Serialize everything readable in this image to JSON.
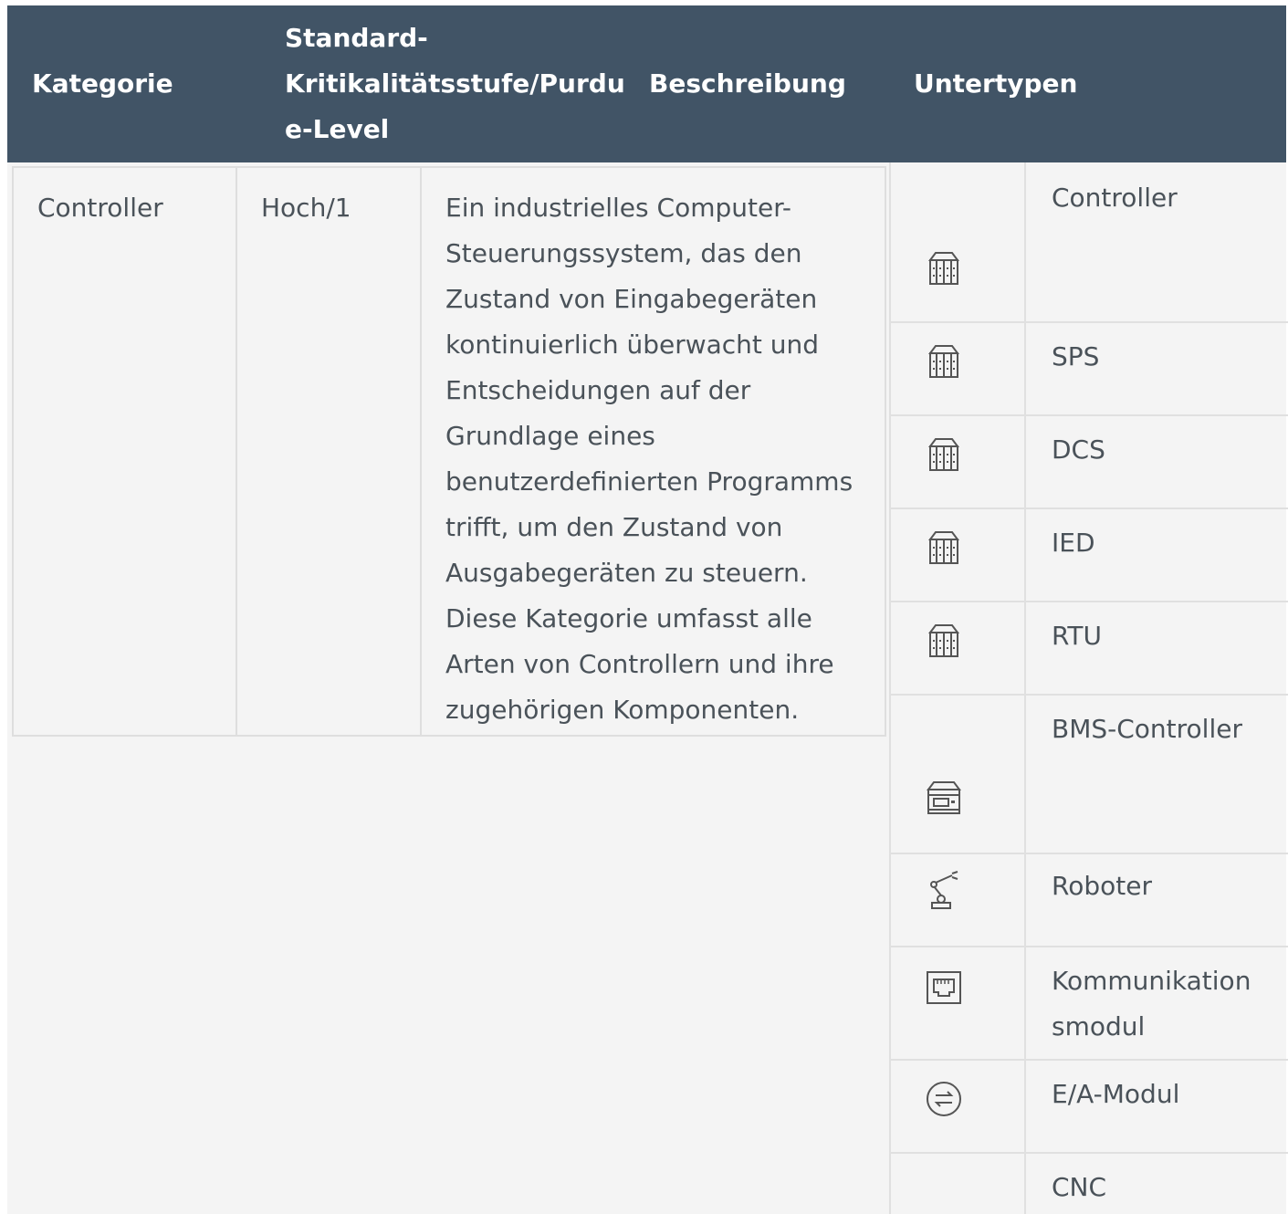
{
  "header": {
    "kategorie": "Kategorie",
    "standard_line1": "Standard-",
    "standard_line2": "Kritikalitätsstufe/Purdu",
    "standard_line3": "e-Level",
    "beschreibung": "Beschreibung",
    "untertypen": "Untertypen"
  },
  "row": {
    "kategorie": "Controller",
    "level": "Hoch/1",
    "beschreibung_lines": [
      "Ein industrielles Computer-",
      "Steuerungssystem, das den",
      "Zustand von Eingabegeräten",
      "kontinuierlich überwacht und",
      "Entscheidungen auf der",
      "Grundlage eines",
      "benutzerdefinierten Programms",
      "trifft, um den Zustand von",
      "Ausgabegeräten zu steuern.",
      "Diese Kategorie umfasst alle",
      "Arten von Controllern und ihre",
      "zugehörigen Komponenten."
    ]
  },
  "subtypes": [
    {
      "label_lines": [
        "Controller"
      ],
      "icon": "controller-rack-icon"
    },
    {
      "label_lines": [
        "SPS"
      ],
      "icon": "controller-rack-icon"
    },
    {
      "label_lines": [
        "DCS"
      ],
      "icon": "controller-rack-icon"
    },
    {
      "label_lines": [
        "IED"
      ],
      "icon": "controller-rack-icon"
    },
    {
      "label_lines": [
        "RTU"
      ],
      "icon": "controller-rack-icon"
    },
    {
      "label_lines": [
        "BMS-Controller"
      ],
      "icon": "bms-controller-icon"
    },
    {
      "label_lines": [
        "Roboter"
      ],
      "icon": "robot-arm-icon"
    },
    {
      "label_lines": [
        "Kommunikation",
        "smodul"
      ],
      "icon": "network-port-icon"
    },
    {
      "label_lines": [
        "E/A-Modul"
      ],
      "icon": "io-exchange-icon"
    },
    {
      "label_lines": [
        "CNC"
      ],
      "icon": ""
    }
  ],
  "colors": {
    "header_bg": "#415466",
    "header_text": "#ffffff",
    "body_bg": "#f4f4f4",
    "text": "#4a5259",
    "border": "#dedede"
  }
}
